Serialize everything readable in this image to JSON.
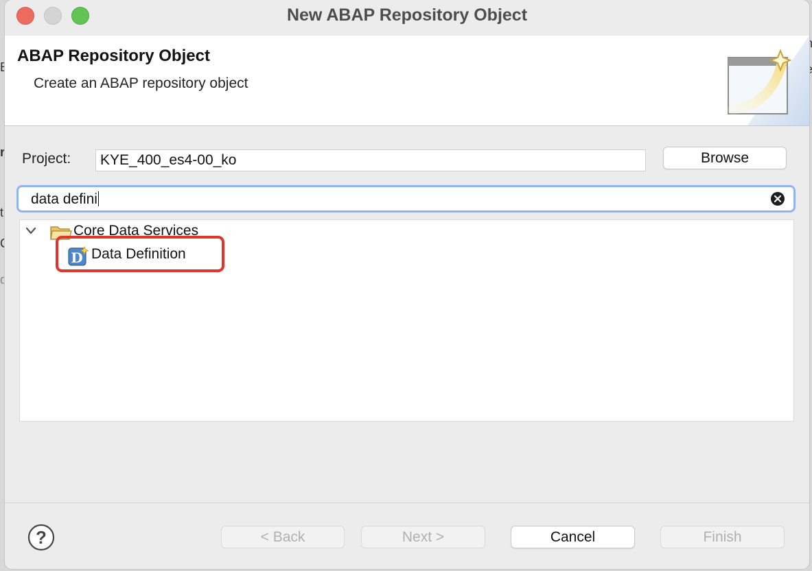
{
  "window": {
    "title": "New ABAP Repository Object"
  },
  "header": {
    "title": "ABAP Repository Object",
    "subtitle": "Create an ABAP repository object"
  },
  "form": {
    "project_label": "Project:",
    "project_value": "KYE_400_es4-00_ko",
    "browse_label": "Browse"
  },
  "search": {
    "value": "data defini"
  },
  "tree": {
    "folder": {
      "label": "Core Data Services",
      "expanded": true
    },
    "selected_item": {
      "label": "Data Definition",
      "highlighted": true
    }
  },
  "buttons": {
    "back": "< Back",
    "next": "Next >",
    "cancel": "Cancel",
    "finish": "Finish"
  },
  "background_fragments": [
    "B",
    "r",
    "t",
    "C",
    "d",
    "n",
    "e"
  ],
  "colors": {
    "highlight": "#e0352b",
    "search_focus": "#8fb4ef",
    "close": "#ed6a5e",
    "maximize": "#61c454"
  },
  "icons": {
    "folder": "folder-icon",
    "data_definition": "data-definition-icon",
    "clear": "clear-search-icon",
    "help": "help-icon",
    "chevron": "chevron-down-icon"
  }
}
